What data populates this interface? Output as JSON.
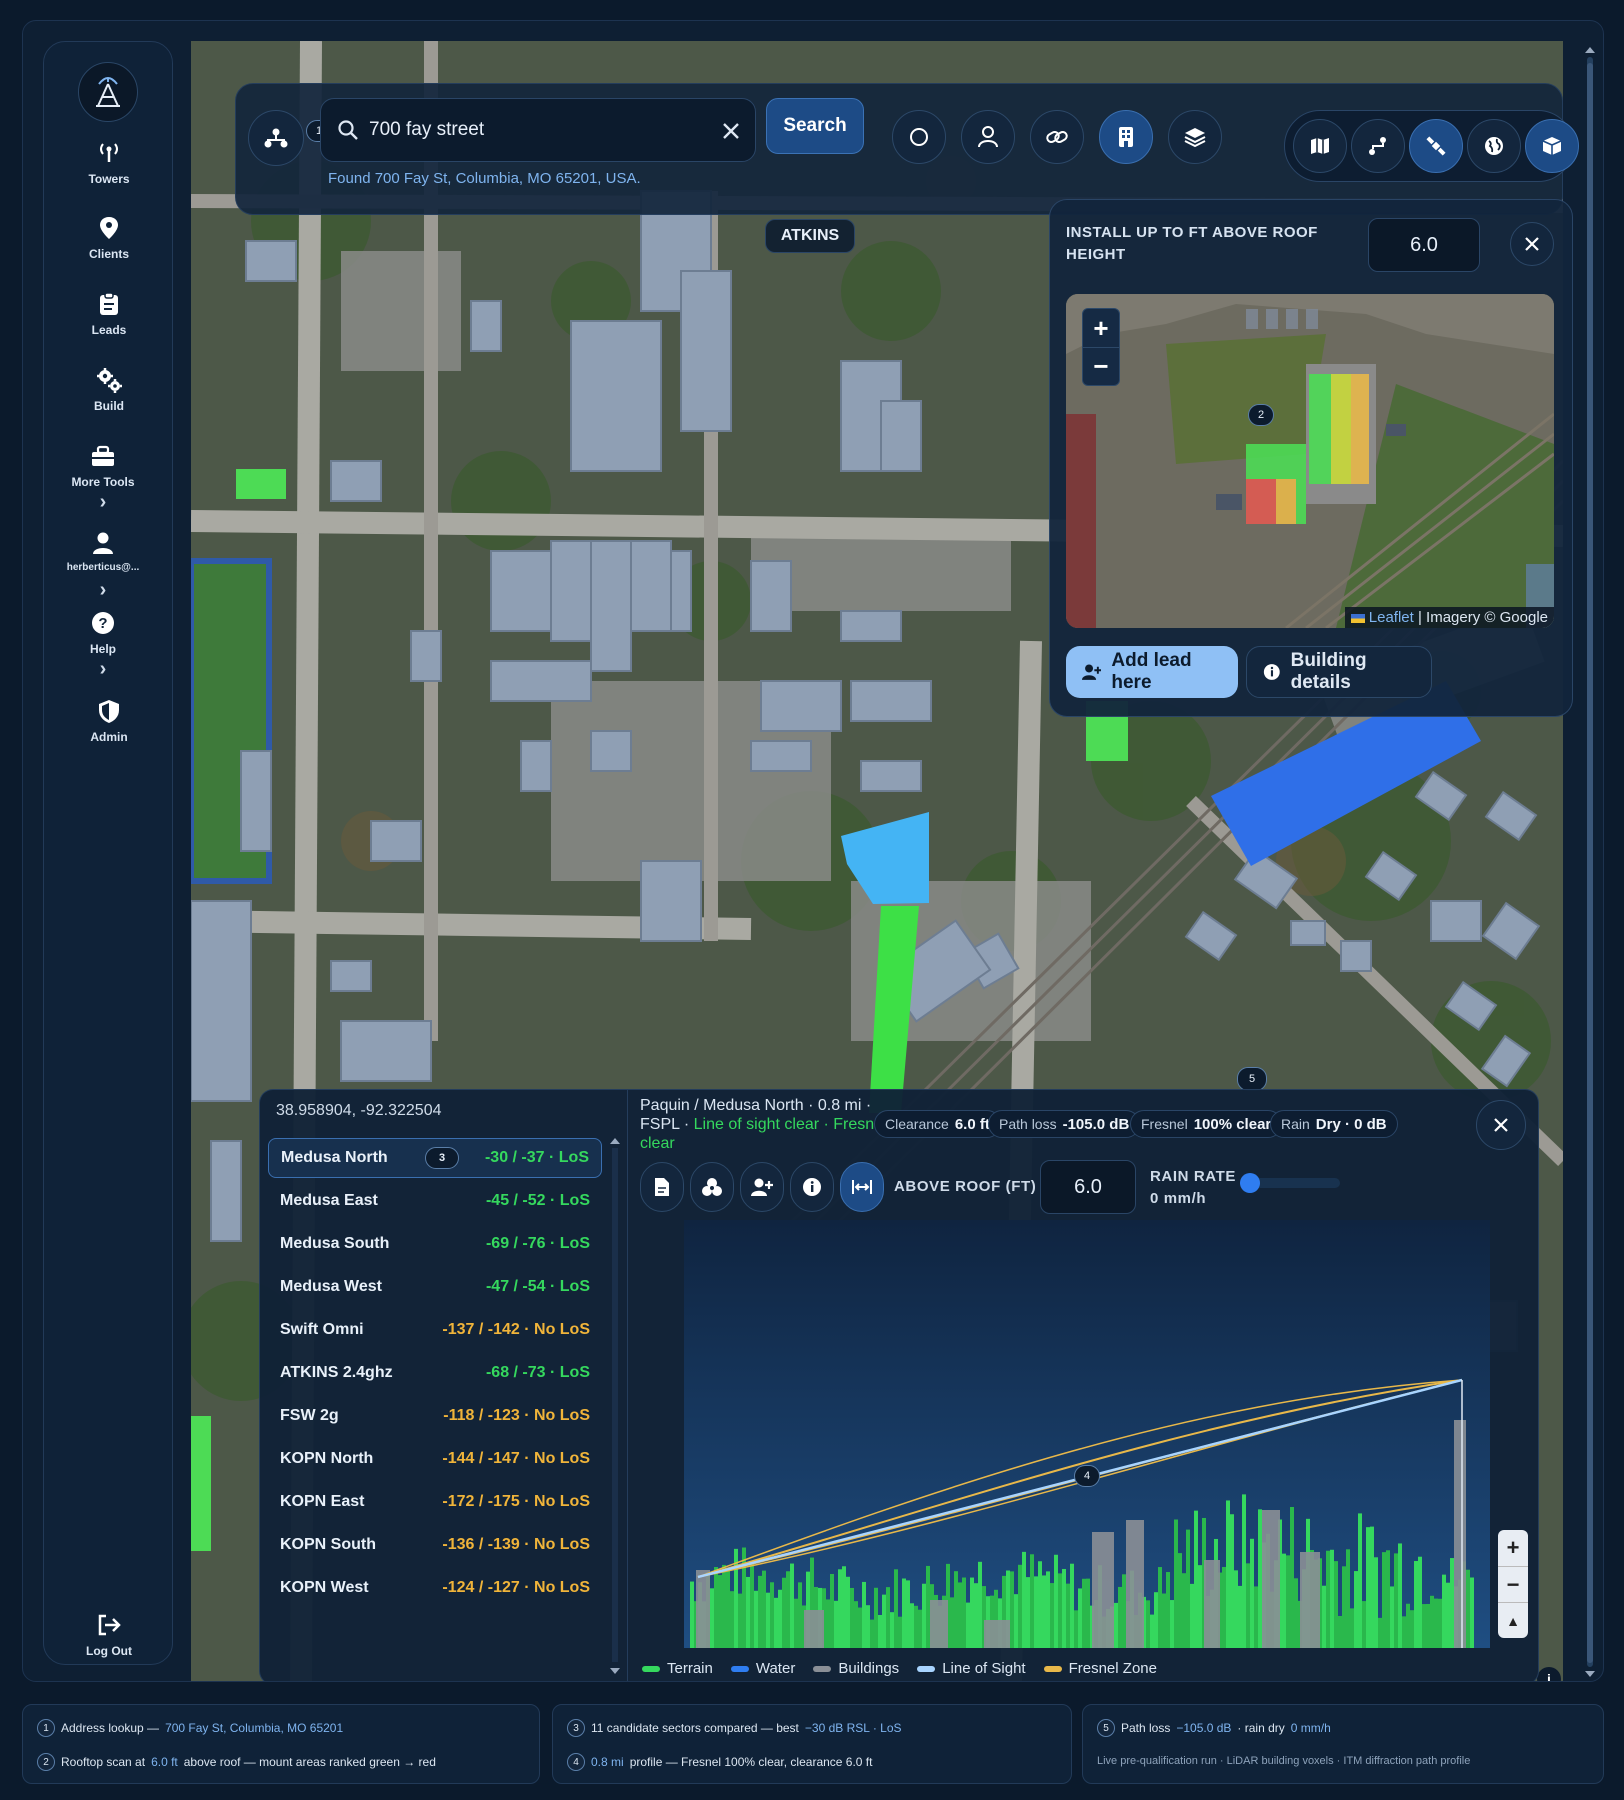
{
  "sidebar": {
    "items": [
      {
        "label": "Towers",
        "icon": "antenna-icon"
      },
      {
        "label": "Clients",
        "icon": "map-pin-icon"
      },
      {
        "label": "Leads",
        "icon": "clipboard-icon"
      },
      {
        "label": "Build",
        "icon": "gears-icon"
      },
      {
        "label": "More Tools",
        "icon": "toolbox-icon"
      },
      {
        "label": "herberticus@...",
        "icon": "user-icon"
      },
      {
        "label": "Help",
        "icon": "help-icon"
      },
      {
        "label": "Admin",
        "icon": "shield-icon"
      }
    ],
    "logout": "Log Out"
  },
  "toolbar": {
    "search_value": "700 fay street",
    "search_button": "Search",
    "found_text": "Found 700 Fay St, Columbia, MO 65201, USA."
  },
  "map": {
    "place_label": "ATKINS"
  },
  "popup": {
    "title": "INSTALL UP TO FT ABOVE ROOF HEIGHT",
    "height_value": "6.0",
    "attribution_leaflet": "Leaflet",
    "attribution_imagery": "| Imagery © Google",
    "add_lead": "Add lead here",
    "building_details": "Building details"
  },
  "coords": {
    "latlon": "38.958904, -92.322504",
    "sectors": [
      {
        "name": "Medusa North",
        "value": "-30 / -37 · LoS",
        "los": true
      },
      {
        "name": "Medusa East",
        "value": "-45 / -52 · LoS",
        "los": true
      },
      {
        "name": "Medusa South",
        "value": "-69 / -76 · LoS",
        "los": true
      },
      {
        "name": "Medusa West",
        "value": "-47 / -54 · LoS",
        "los": true
      },
      {
        "name": "Swift Omni",
        "value": "-137 / -142 · No LoS",
        "los": false
      },
      {
        "name": "ATKINS 2.4ghz",
        "value": "-68 / -73 · LoS",
        "los": true
      },
      {
        "name": "FSW 2g",
        "value": "-118 / -123 · No LoS",
        "los": false
      },
      {
        "name": "KOPN North",
        "value": "-144 / -147 · No LoS",
        "los": false
      },
      {
        "name": "KOPN East",
        "value": "-172 / -175 · No LoS",
        "los": false
      },
      {
        "name": "KOPN South",
        "value": "-136 / -139 · No LoS",
        "los": false
      },
      {
        "name": "KOPN West",
        "value": "-124 / -127 · No LoS",
        "los": false
      }
    ]
  },
  "profile": {
    "header_main": "Paquin / Medusa North · 0.8 mi ·",
    "header_fspl": "FSPL ·",
    "header_status": "Line of sight clear · Fresnel clear",
    "chips": [
      {
        "label": "Clearance",
        "value": "6.0 ft"
      },
      {
        "label": "Path loss",
        "value": "-105.0 dB"
      },
      {
        "label": "Fresnel",
        "value": "100% clear"
      },
      {
        "label": "Rain",
        "value": "Dry · 0 dB"
      }
    ],
    "above_roof_label": "ABOVE ROOF (FT)",
    "above_roof_value": "6.0",
    "rain_label": "RAIN RATE",
    "rain_value": "0 mm/h",
    "rain_rate_fraction": 0,
    "legend": [
      {
        "label": "Terrain",
        "color": "#35d85e"
      },
      {
        "label": "Water",
        "color": "#2f7df0"
      },
      {
        "label": "Buildings",
        "color": "#8a8f96"
      },
      {
        "label": "Line of Sight",
        "color": "#a8d4ff"
      },
      {
        "label": "Fresnel Zone",
        "color": "#e8b84a"
      }
    ]
  },
  "footer": {
    "c1": [
      {
        "n": "1",
        "pre": "Address lookup —",
        "hl": "700 Fay St, Columbia, MO 65201",
        "post": ""
      },
      {
        "n": "2",
        "pre": "Rooftop scan at",
        "hl": "6.0 ft",
        "post": "above roof — mount areas ranked green → red"
      }
    ],
    "c2": [
      {
        "n": "3",
        "pre": "11 candidate sectors compared — best",
        "hl": "−30 dB RSL · LoS",
        "post": ""
      },
      {
        "n": "4",
        "pre": "",
        "hl": "0.8 mi",
        "post": "profile — Fresnel 100% clear, clearance 6.0 ft"
      }
    ],
    "c3": {
      "n": "5",
      "pre": "Path loss",
      "hl": "−105.0 dB",
      "post": "· rain dry",
      "hl2": "0 mm/h",
      "note": "Live pre-qualification run · LiDAR building voxels · ITM diffraction path profile"
    }
  }
}
